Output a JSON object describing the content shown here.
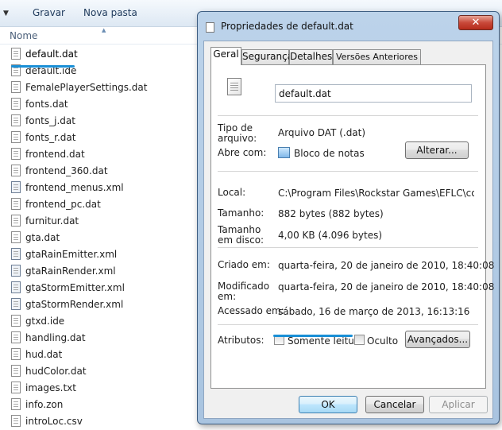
{
  "explorer": {
    "toolbar": {
      "burn": "Gravar",
      "new_folder": "Nova pasta"
    },
    "column_name": "Nome",
    "files": [
      {
        "name": "default.dat",
        "type": "dat"
      },
      {
        "name": "default.ide",
        "type": "dat"
      },
      {
        "name": "FemalePlayerSettings.dat",
        "type": "dat"
      },
      {
        "name": "fonts.dat",
        "type": "dat"
      },
      {
        "name": "fonts_j.dat",
        "type": "dat"
      },
      {
        "name": "fonts_r.dat",
        "type": "dat"
      },
      {
        "name": "frontend.dat",
        "type": "dat"
      },
      {
        "name": "frontend_360.dat",
        "type": "dat"
      },
      {
        "name": "frontend_menus.xml",
        "type": "xml"
      },
      {
        "name": "frontend_pc.dat",
        "type": "dat"
      },
      {
        "name": "furnitur.dat",
        "type": "dat"
      },
      {
        "name": "gta.dat",
        "type": "dat"
      },
      {
        "name": "gtaRainEmitter.xml",
        "type": "xml"
      },
      {
        "name": "gtaRainRender.xml",
        "type": "xml"
      },
      {
        "name": "gtaStormEmitter.xml",
        "type": "xml"
      },
      {
        "name": "gtaStormRender.xml",
        "type": "xml"
      },
      {
        "name": "gtxd.ide",
        "type": "dat"
      },
      {
        "name": "handling.dat",
        "type": "dat"
      },
      {
        "name": "hud.dat",
        "type": "dat"
      },
      {
        "name": "hudColor.dat",
        "type": "dat"
      },
      {
        "name": "images.txt",
        "type": "dat"
      },
      {
        "name": "info.zon",
        "type": "dat"
      },
      {
        "name": "introLoc.csv",
        "type": "dat"
      }
    ]
  },
  "dialog": {
    "title": "Propriedades de default.dat",
    "close_label": "✕",
    "tabs": [
      "Geral",
      "Segurança",
      "Detalhes",
      "Versões Anteriores"
    ],
    "file_name": "default.dat",
    "type_label": "Tipo de arquivo:",
    "type_value": "Arquivo DAT (.dat)",
    "opens_with_label": "Abre com:",
    "opens_with_value": "Bloco de notas",
    "change_button": "Alterar...",
    "location_label": "Local:",
    "location_value": "C:\\Program Files\\Rockstar Games\\EFLC\\common\\c",
    "size_label": "Tamanho:",
    "size_value": "882 bytes (882 bytes)",
    "size_on_disk_label": "Tamanho em disco:",
    "size_on_disk_value": "4,00 KB (4.096 bytes)",
    "created_label": "Criado em:",
    "created_value": "quarta-feira, 20 de janeiro de 2010, 18:40:08",
    "modified_label": "Modificado em:",
    "modified_value": "quarta-feira, 20 de janeiro de 2010, 18:40:08",
    "accessed_label": "Acessado em:",
    "accessed_value": "sábado, 16 de março de 2013, 16:13:16",
    "attributes_label": "Atributos:",
    "readonly_label": "Somente leitura",
    "hidden_label": "Oculto",
    "advanced_button": "Avançados...",
    "ok_button": "OK",
    "cancel_button": "Cancelar",
    "apply_button": "Aplicar"
  },
  "colors": {
    "highlight_underline": "#1a8fd6",
    "title_bar": "#bcd3ea",
    "close_button": "#c8493a"
  }
}
